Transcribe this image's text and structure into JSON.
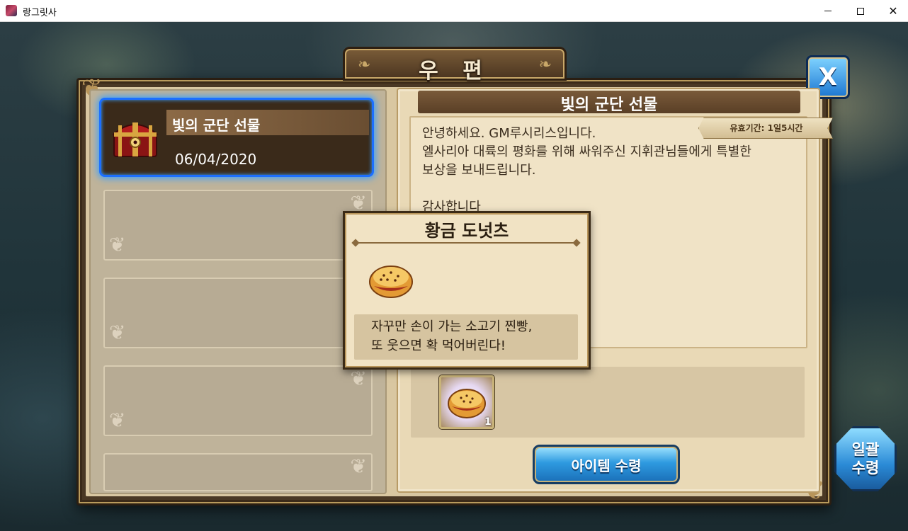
{
  "window": {
    "title": "랑그릿사",
    "minimize_icon": "minimize-icon",
    "maximize_icon": "maximize-icon",
    "close_glyph": "✕"
  },
  "header": {
    "title": "우 편",
    "close_label": "X"
  },
  "mail_list": {
    "selected": {
      "name": "빛의 군단 선물",
      "date": "06/04/2020",
      "icon": "treasure-chest-icon"
    },
    "empty_slots": 4
  },
  "message": {
    "title": "빛의 군단 선물",
    "expire": "유효기간: 1일5시간",
    "body": "안녕하세요. GM루시리스입니다.\n엘사리아 대륙의 평화를 위해 싸워주신 지휘관님들에게 특별한\n보상을 보내드립니다.\n\n감사합니다"
  },
  "reward": {
    "icon": "golden-donut-icon",
    "count": "1"
  },
  "buttons": {
    "receive_item": "아이템 수령",
    "bulk_receive": "일괄\n수령"
  },
  "tooltip": {
    "title": "황금 도넛츠",
    "icon": "golden-donut-icon",
    "description": "자꾸만 손이 가는 소고기 찐빵,\n또 웃으면 확 먹어버린다!"
  },
  "colors": {
    "selected_glow": "#1c6fff",
    "button_blue": "#2e9ae0",
    "frame_brown": "#4a3824",
    "parchment": "#e9d9b6"
  }
}
